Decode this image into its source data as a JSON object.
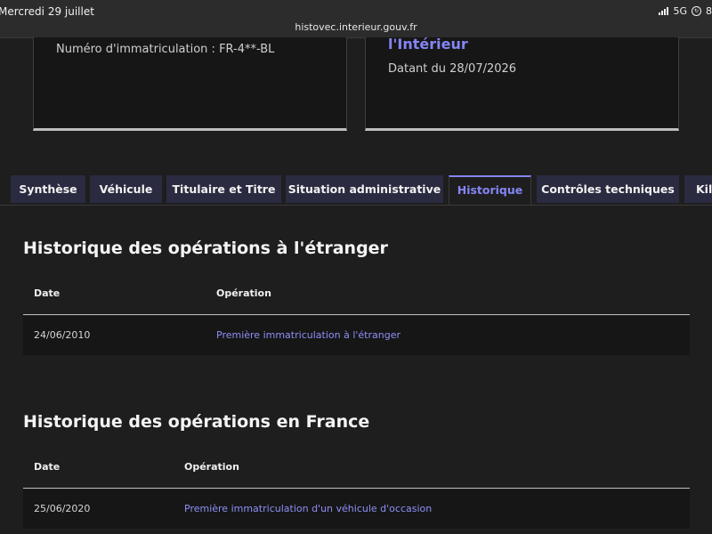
{
  "status_bar": {
    "date": "Mercredi 29 juillet",
    "url": "histovec.interieur.gouv.fr",
    "network": "5G",
    "battery": "8"
  },
  "cards": {
    "left": {
      "registration": "Numéro d'immatriculation : FR-4**-BL"
    },
    "right": {
      "title": "l'Intérieur",
      "dated": "Datant du 28/07/2026"
    }
  },
  "tabs": [
    {
      "label": "Synthèse",
      "active": false
    },
    {
      "label": "Véhicule",
      "active": false
    },
    {
      "label": "Titulaire et Titre",
      "active": false
    },
    {
      "label": "Situation administrative",
      "active": false
    },
    {
      "label": "Historique",
      "active": true
    },
    {
      "label": "Contrôles techniques",
      "active": false
    },
    {
      "label": "Kilo",
      "active": false
    }
  ],
  "abroad": {
    "title": "Historique des opérations à l'étranger",
    "headers": {
      "date": "Date",
      "operation": "Opération"
    },
    "rows": [
      {
        "date": "24/06/2010",
        "operation": "Première immatriculation à l'étranger"
      }
    ]
  },
  "france": {
    "title": "Historique des opérations en France",
    "headers": {
      "date": "Date",
      "operation": "Opération"
    },
    "rows": [
      {
        "date": "25/06/2020",
        "operation": "Première immatriculation d'un véhicule d'occasion"
      }
    ]
  },
  "colors": {
    "accent": "#8585f6",
    "tab_bg": "#2a2a40",
    "background": "#1e1e1e"
  }
}
